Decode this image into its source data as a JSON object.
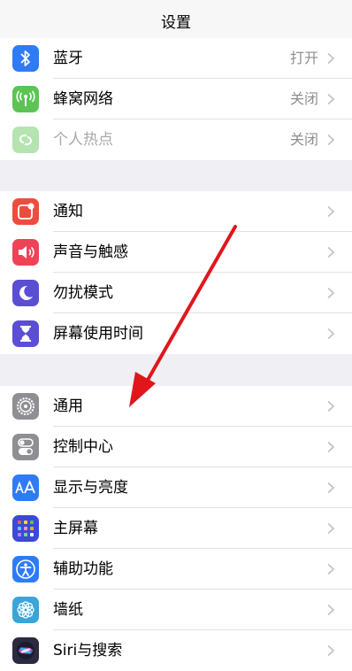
{
  "header": {
    "title": "设置"
  },
  "groups": [
    {
      "items": [
        {
          "label": "蓝牙",
          "value": "打开",
          "icon": "bluetooth-icon",
          "color": "#2f7bf6"
        },
        {
          "label": "蜂窝网络",
          "value": "关闭",
          "icon": "cellular-icon",
          "color": "#5cc455"
        },
        {
          "label": "个人热点",
          "value": "关闭",
          "icon": "hotspot-icon",
          "color": "#5cc455"
        }
      ]
    },
    {
      "items": [
        {
          "label": "通知",
          "icon": "notification-icon",
          "color": "#ee4c3f"
        },
        {
          "label": "声音与触感",
          "icon": "speaker-icon",
          "color": "#ee4257"
        },
        {
          "label": "勿扰模式",
          "icon": "moon-icon",
          "color": "#5b4dd4"
        },
        {
          "label": "屏幕使用时间",
          "icon": "hourglass-icon",
          "color": "#5b4dd4"
        }
      ]
    },
    {
      "items": [
        {
          "label": "通用",
          "icon": "gear-icon",
          "color": "#8e8e93"
        },
        {
          "label": "控制中心",
          "icon": "toggles-icon",
          "color": "#8e8e93"
        },
        {
          "label": "显示与亮度",
          "icon": "display-aa-icon",
          "color": "#2f7bf6"
        },
        {
          "label": "主屏幕",
          "icon": "home-grid-icon",
          "color": "#3c48d8"
        },
        {
          "label": "辅助功能",
          "icon": "accessibility-icon",
          "color": "#2f7bf6"
        },
        {
          "label": "墙纸",
          "icon": "wallpaper-icon",
          "color": "#39a5d8"
        },
        {
          "label": "Siri与搜索",
          "icon": "siri-icon",
          "color": "#2a2a40"
        }
      ]
    }
  ],
  "annotation": {
    "color": "#e0161b"
  }
}
